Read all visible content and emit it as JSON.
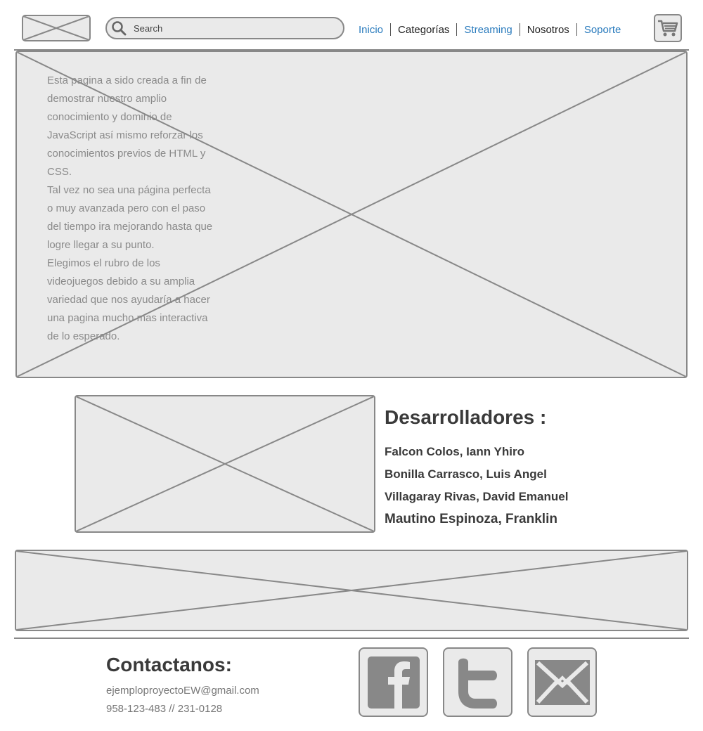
{
  "header": {
    "search_placeholder": "Search",
    "nav": [
      {
        "label": "Inicio",
        "color": "#2a7bbd"
      },
      {
        "label": "Categorías",
        "color": "#222222"
      },
      {
        "label": "Streaming",
        "color": "#2a7bbd"
      },
      {
        "label": "Nosotros",
        "color": "#222222"
      },
      {
        "label": "Soporte",
        "color": "#2a7bbd"
      }
    ],
    "icons": {
      "logo": "image-placeholder",
      "search": "search-icon",
      "cart": "cart-icon"
    }
  },
  "hero": {
    "paragraphs": [
      "Esta pagina a sido creada a fin de demostrar nuestro amplio conocimiento y dominio de JavaScript así mismo reforzar los conocimientos previos de HTML y CSS.",
      "Tal vez no sea una página perfecta o muy avanzada pero con el paso del tiempo ira mejorando hasta que logre llegar a su punto.",
      "Elegimos el rubro de los videojuegos debido a su amplia variedad que nos ayudaría a hacer una pagina mucho mas interactiva de lo esperado."
    ]
  },
  "developers": {
    "title": "Desarrolladores :",
    "names": [
      "Falcon Colos, Iann Yhiro",
      "Bonilla Carrasco, Luis Angel",
      "Villagaray Rivas, David Emanuel",
      "Mautino Espinoza, Franklin"
    ]
  },
  "footer": {
    "title": "Contactanos:",
    "email": "ejemploproyectoEW@gmail.com",
    "phone": "958-123-483 // 231-0128",
    "social_icons": [
      "facebook-icon",
      "twitter-icon",
      "mail-icon"
    ]
  },
  "colors": {
    "accent": "#2a7bbd",
    "placeholder_fill": "#eaeaea",
    "placeholder_stroke": "#888888"
  }
}
